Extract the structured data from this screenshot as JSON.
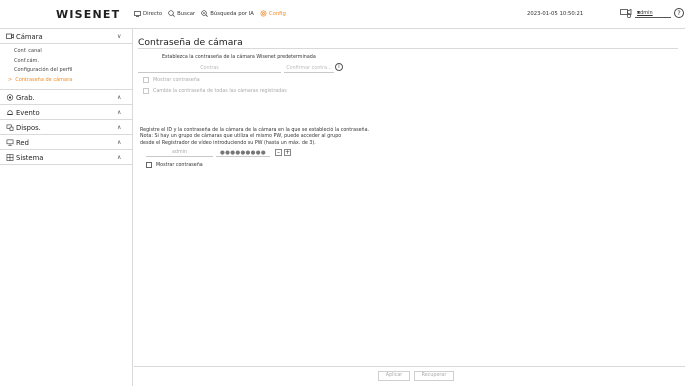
{
  "header": {
    "logo": "WISENET",
    "nav": [
      {
        "label": "Directo",
        "icon": "monitor-icon"
      },
      {
        "label": "Buscar",
        "icon": "search-icon"
      },
      {
        "label": "Búsqueda por IA",
        "icon": "ai-search-icon"
      },
      {
        "label": "Config",
        "icon": "gear-icon",
        "active": true
      }
    ],
    "datetime": "2023-01-05 10:50:21",
    "user": "admin",
    "help": "?"
  },
  "sidebar": {
    "groups": [
      {
        "label": "Cámara",
        "icon": "camera-icon",
        "chevron": "∨",
        "expanded": true,
        "items": [
          {
            "label": "Conf. canal"
          },
          {
            "label": "Conf.cám."
          },
          {
            "label": "Configuración del perfil"
          },
          {
            "label": "Contraseña de cámara",
            "active": true,
            "prefix": ">"
          }
        ]
      },
      {
        "label": "Grab.",
        "icon": "record-icon",
        "chevron": "∧"
      },
      {
        "label": "Evento",
        "icon": "bell-icon",
        "chevron": "∧"
      },
      {
        "label": "Dispos.",
        "icon": "device-icon",
        "chevron": "∧"
      },
      {
        "label": "Red",
        "icon": "network-icon",
        "chevron": "∧"
      },
      {
        "label": "Sistema",
        "icon": "system-icon",
        "chevron": "∧"
      }
    ]
  },
  "main": {
    "title": "Contraseña de cámara",
    "default_password": {
      "instruction": "Establezca la contraseña de la cámara Wisenet predeterminada",
      "password_placeholder": "Contras",
      "confirm_placeholder": "Confirmar contra...",
      "info": "i",
      "show_password": "Mostrar contraseña",
      "change_all": "Cambie la contraseña de todas las cámaras registradas"
    },
    "group_password": {
      "note_line1": "Registre el ID y la contraseña de la cámara de la cámara en la que se estableció la contraseña.",
      "note_line2": "Nota: Si hay un grupo de cámaras que utiliza el mismo PW, puede acceder al grupo",
      "note_line3": "desde el Registrador de vídeo introduciendo su PW (hasta un máx. de 3).",
      "id_value": "admin",
      "password_value": "●●●●●●●●●",
      "minus": "–",
      "plus": "+",
      "show_password": "Mostrar contraseña"
    },
    "buttons": {
      "apply": "Aplicar",
      "restore": "Recuperar"
    }
  },
  "colors": {
    "accent": "#f08a24",
    "border": "#d9d9d9"
  }
}
